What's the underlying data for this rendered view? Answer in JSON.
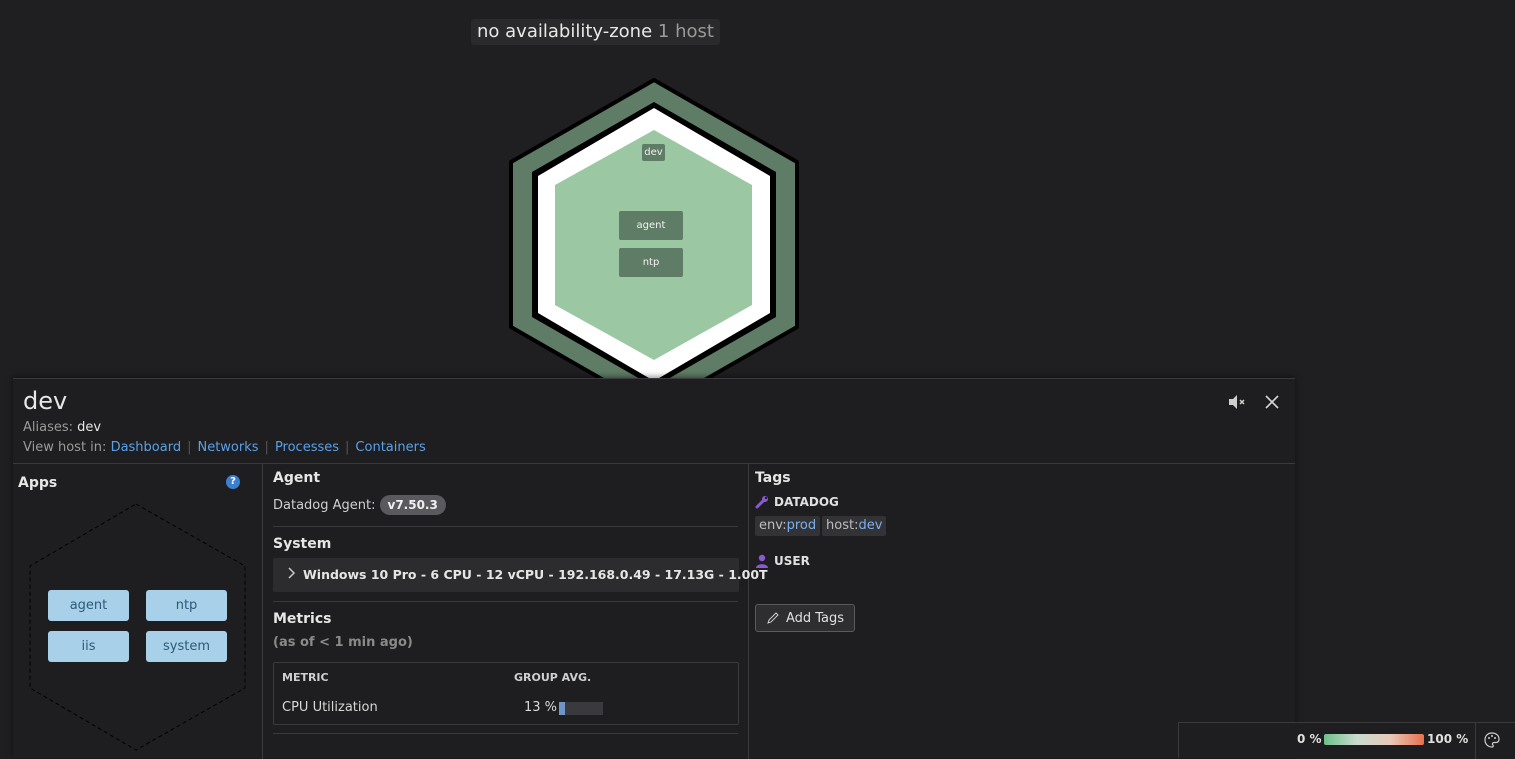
{
  "map": {
    "group_title": "no availability-zone",
    "group_count": "1 host",
    "hex": {
      "host_label": "dev",
      "apps": [
        "agent",
        "ntp"
      ],
      "fill_color": "#9bc8a2",
      "border_color": "#5f7d66"
    }
  },
  "panel": {
    "host_name": "dev",
    "aliases_label": "Aliases:",
    "aliases_value": "dev",
    "view_in_label": "View host in:",
    "view_links": [
      "Dashboard",
      "Networks",
      "Processes",
      "Containers"
    ],
    "apps": {
      "title": "Apps",
      "help": "?",
      "items": [
        "agent",
        "ntp",
        "iis",
        "system"
      ]
    },
    "agent": {
      "title": "Agent",
      "label": "Datadog Agent:",
      "version": "v7.50.3"
    },
    "system": {
      "title": "System",
      "summary": "Windows 10 Pro - 6 CPU - 12 vCPU - 192.168.0.49 - 17.13G - 1.00T"
    },
    "metrics": {
      "title": "Metrics",
      "subtitle": "(as of < 1 min ago)",
      "headers": [
        "METRIC",
        "GROUP AVG."
      ],
      "rows": [
        {
          "metric": "CPU Utilization",
          "value": "13 %",
          "fraction": 0.13
        }
      ]
    },
    "tags": {
      "title": "Tags",
      "datadog_label": "DATADOG",
      "datadog_tags": [
        {
          "key": "env:",
          "value": "prod"
        },
        {
          "key": "host:",
          "value": "dev"
        }
      ],
      "user_label": "USER",
      "add_button": "Add Tags"
    }
  },
  "legend": {
    "min": "0 %",
    "max": "100 %",
    "gradient_colors": [
      "#6fc08a",
      "#c9dccf",
      "#e8c8b8",
      "#e8704d"
    ]
  }
}
